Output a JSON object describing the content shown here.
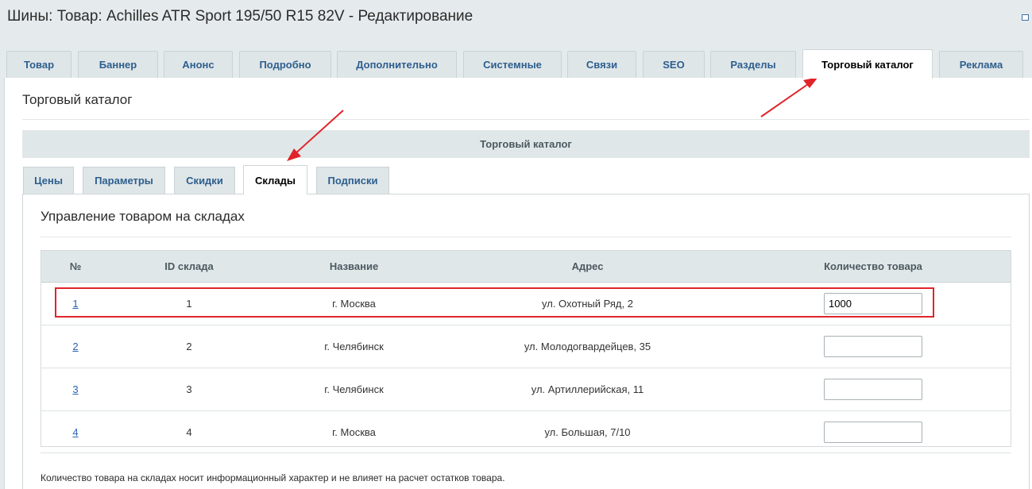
{
  "window": {
    "title": "Шины: Товар: Achilles ATR Sport 195/50 R15 82V - Редактирование"
  },
  "top_tabs": [
    {
      "label": "Товар"
    },
    {
      "label": "Баннер"
    },
    {
      "label": "Анонс"
    },
    {
      "label": "Подробно"
    },
    {
      "label": "Дополнительно"
    },
    {
      "label": "Системные"
    },
    {
      "label": "Связи"
    },
    {
      "label": "SEO"
    },
    {
      "label": "Разделы"
    },
    {
      "label": "Торговый каталог",
      "active": true
    },
    {
      "label": "Реклама"
    }
  ],
  "section": {
    "title": "Торговый каталог",
    "group_header": "Торговый каталог"
  },
  "sub_tabs": [
    {
      "label": "Цены"
    },
    {
      "label": "Параметры"
    },
    {
      "label": "Скидки"
    },
    {
      "label": "Склады",
      "active": true
    },
    {
      "label": "Подписки"
    }
  ],
  "stores": {
    "title": "Управление товаром на складах",
    "columns": [
      "№",
      "ID склада",
      "Название",
      "Адрес",
      "Количество товара"
    ],
    "rows": [
      {
        "num": "1",
        "id": "1",
        "name": "г. Москва",
        "address": "ул. Охотный Ряд, 2",
        "qty": "1000"
      },
      {
        "num": "2",
        "id": "2",
        "name": "г. Челябинск",
        "address": "ул. Молодогвардейцев, 35",
        "qty": ""
      },
      {
        "num": "3",
        "id": "3",
        "name": "г. Челябинск",
        "address": "ул. Артиллерийская, 11",
        "qty": ""
      },
      {
        "num": "4",
        "id": "4",
        "name": "г. Москва",
        "address": "ул. Большая, 7/10",
        "qty": ""
      }
    ],
    "note": "Количество товара на складах носит информационный характер и не влияет на расчет остатков товара."
  },
  "colors": {
    "accent": "#2d5e8e",
    "annotation": "#e0242a",
    "header_bg": "#e0e7e9"
  },
  "icons": {
    "window_restore": "restore-icon"
  }
}
